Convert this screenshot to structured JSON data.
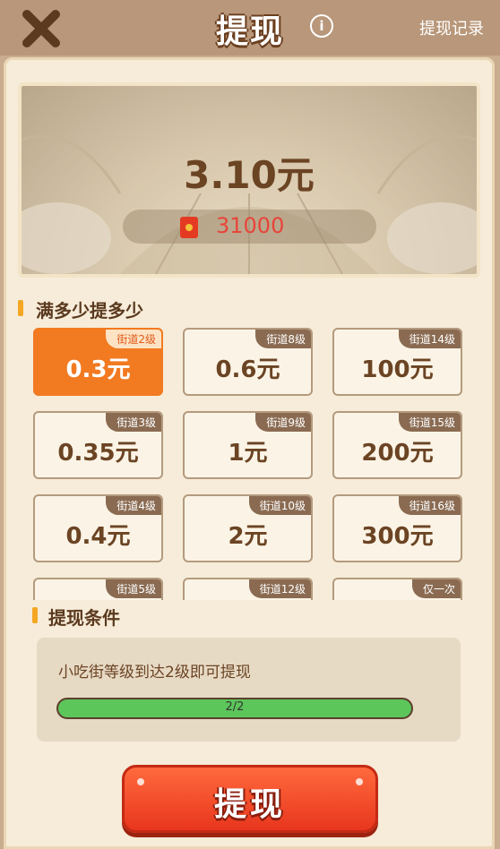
{
  "header": {
    "title": "提现",
    "info_icon": "i",
    "record_label": "提现记录"
  },
  "hero": {
    "amount": "3.10元",
    "coins": "31000"
  },
  "tiers_section": {
    "title": "满多少提多少",
    "selected_index": 0,
    "cells": [
      {
        "value": "0.3元",
        "tag": "街道2级"
      },
      {
        "value": "0.6元",
        "tag": "街道8级"
      },
      {
        "value": "100元",
        "tag": "街道14级"
      },
      {
        "value": "0.35元",
        "tag": "街道3级"
      },
      {
        "value": "1元",
        "tag": "街道9级"
      },
      {
        "value": "200元",
        "tag": "街道15级"
      },
      {
        "value": "0.4元",
        "tag": "街道4级"
      },
      {
        "value": "2元",
        "tag": "街道10级"
      },
      {
        "value": "300元",
        "tag": "街道16级"
      },
      {
        "value": "",
        "tag": "街道5级"
      },
      {
        "value": "",
        "tag": "街道12级"
      },
      {
        "value": "",
        "tag": "仅一次"
      }
    ]
  },
  "condition_section": {
    "title": "提现条件",
    "text": "小吃街等级到达2级即可提现",
    "progress_label": "2/2",
    "progress_fraction": 1.0
  },
  "withdraw_button": {
    "label": "提现"
  },
  "colors": {
    "accent": "#f27a21",
    "progress": "#5cc65a",
    "button": "#e8361e"
  }
}
